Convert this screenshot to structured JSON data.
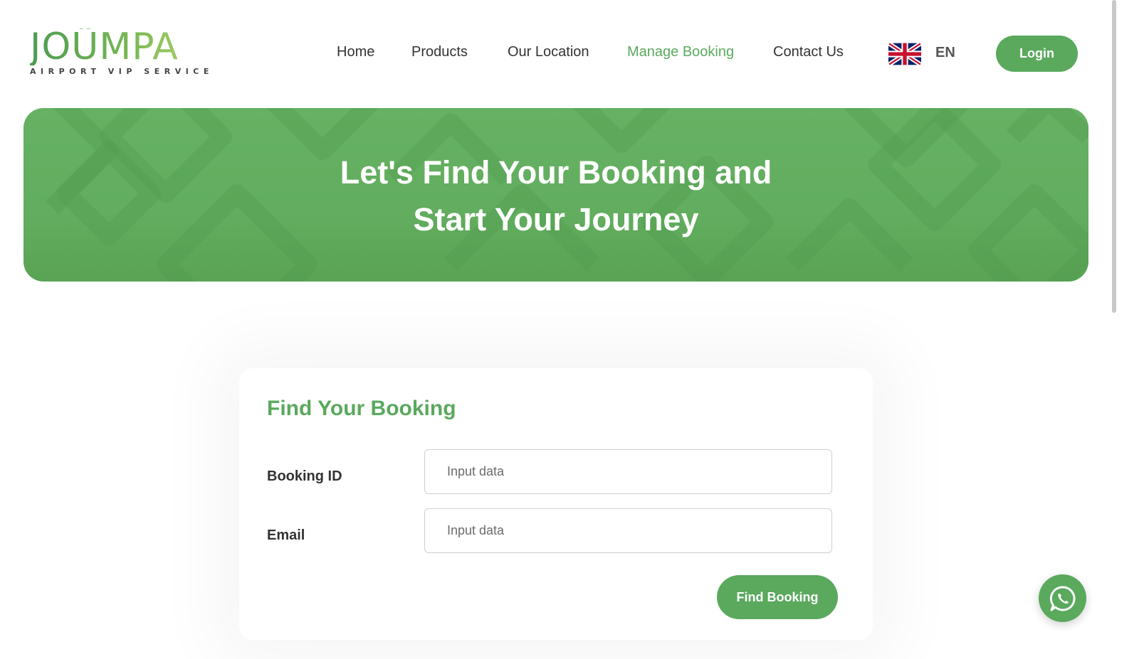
{
  "logo": {
    "word": "JOÜMPA",
    "tagline": "AIRPORT VIP SERVICE"
  },
  "nav": {
    "items": [
      {
        "label": "Home"
      },
      {
        "label": "Products"
      },
      {
        "label": "Our Location"
      },
      {
        "label": "Manage Booking",
        "active": true
      },
      {
        "label": "Contact Us"
      }
    ],
    "language_flag_icon": "uk-flag-icon",
    "language_code": "EN",
    "login_label": "Login"
  },
  "hero": {
    "title_line1": "Let's Find Your Booking and",
    "title_line2": "Start Your Journey"
  },
  "form": {
    "title": "Find Your Booking",
    "booking_id": {
      "label": "Booking ID",
      "placeholder": "Input data",
      "value": ""
    },
    "email": {
      "label": "Email",
      "placeholder": "Input data",
      "value": ""
    },
    "submit_label": "Find Booking"
  },
  "floating": {
    "icon": "whatsapp-icon"
  },
  "colors": {
    "brand_green": "#5aa95d",
    "hero_green": "#64ae61",
    "text_dark": "#333333"
  }
}
